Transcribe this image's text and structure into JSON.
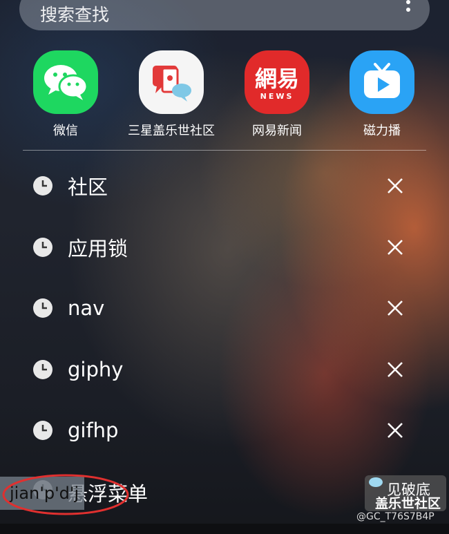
{
  "search": {
    "placeholder": "搜索查找",
    "more": "more-options"
  },
  "apps": [
    {
      "label": "微信",
      "icon": "wechat-icon",
      "color": "#1ED760"
    },
    {
      "label": "三星盖乐世社区",
      "icon": "samsung-members-icon",
      "color": "#F5F5F5"
    },
    {
      "label": "网易新闻",
      "icon": "netease-news-icon",
      "color": "#E12A2A"
    },
    {
      "label": "磁力播",
      "icon": "tv-player-icon",
      "color": "#2AA3F5"
    }
  ],
  "history": [
    {
      "text": "社区"
    },
    {
      "text": "应用锁"
    },
    {
      "text": "nav"
    },
    {
      "text": "giphy"
    },
    {
      "text": "gifhp"
    }
  ],
  "partial_item": {
    "text": "悬浮菜单"
  },
  "ime": {
    "suggestion": "jian'p'd'j"
  },
  "watermark": {
    "line1": "见破底",
    "line2": "盖乐世社区",
    "user": "@GC_T76S7B4P"
  },
  "colors": {
    "accent_red": "#E12A2A",
    "wechat_green": "#1ED760",
    "blue": "#2AA3F5"
  }
}
